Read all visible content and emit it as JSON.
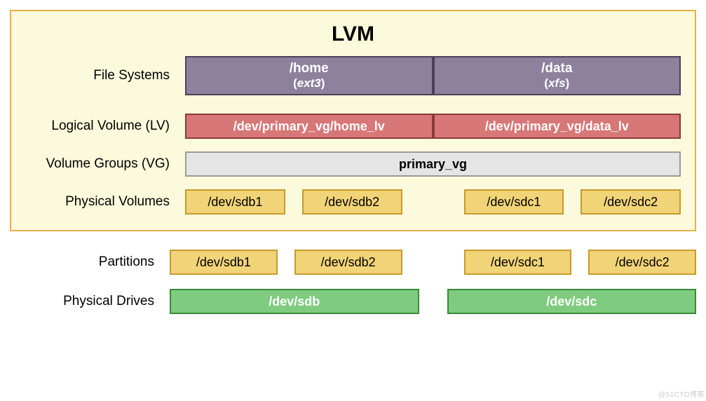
{
  "title": "LVM",
  "labels": {
    "fs": "File Systems",
    "lv": "Logical Volume (LV)",
    "vg": "Volume Groups (VG)",
    "pv": "Physical Volumes",
    "part": "Partitions",
    "pd": "Physical Drives"
  },
  "filesystems": [
    {
      "mount": "/home",
      "type": "ext3"
    },
    {
      "mount": "/data",
      "type": "xfs"
    }
  ],
  "logical_volumes": [
    "/dev/primary_vg/home_lv",
    "/dev/primary_vg/data_lv"
  ],
  "volume_group": "primary_vg",
  "physical_volumes": {
    "g1": [
      "/dev/sdb1",
      "/dev/sdb2"
    ],
    "g2": [
      "/dev/sdc1",
      "/dev/sdc2"
    ]
  },
  "partitions": {
    "g1": [
      "/dev/sdb1",
      "/dev/sdb2"
    ],
    "g2": [
      "/dev/sdc1",
      "/dev/sdc2"
    ]
  },
  "physical_drives": [
    "/dev/sdb",
    "/dev/sdc"
  ],
  "watermark": "@51CTO博客"
}
